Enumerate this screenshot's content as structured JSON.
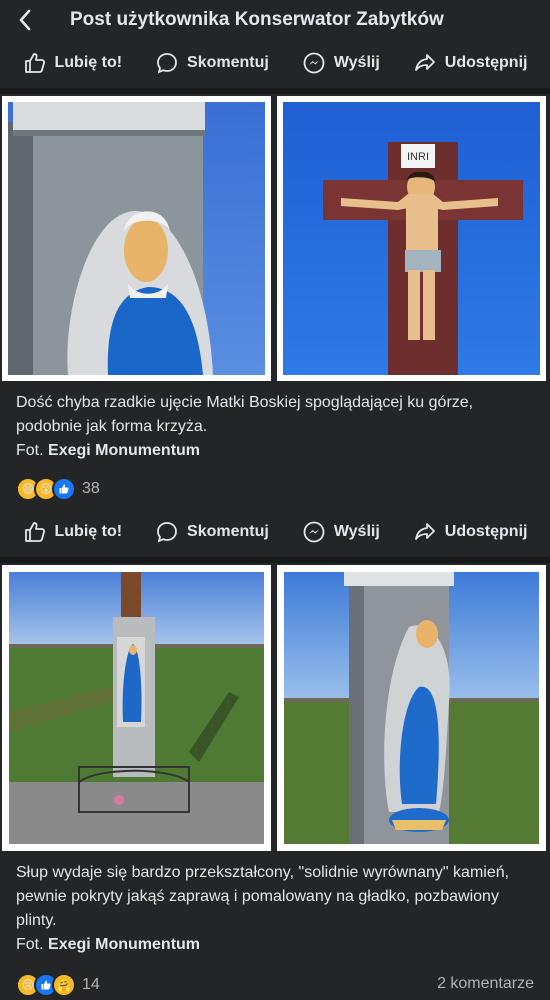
{
  "header": {
    "title": "Post użytkownika Konserwator Zabytków"
  },
  "actions": {
    "like": "Lubię to!",
    "comment": "Skomentuj",
    "send": "Wyślij",
    "share": "Udostępnij"
  },
  "post1": {
    "caption": "Dość chyba rzadkie ujęcie Matki Boskiej spoglądającej ku górze, podobnie jak forma krzyża.",
    "credit_prefix": "Fot.",
    "credit_name": "Exegi Monumentum",
    "reaction_count": "38",
    "inri": "INRI"
  },
  "post2": {
    "caption": "Słup wydaje się bardzo przekształcony, \"solidnie wyrównany\" kamień, pewnie pokryty jakąś zaprawą i pomalowany na gładko, pozbawiony plinty.",
    "credit_prefix": "Fot.",
    "credit_name": "Exegi Monumentum",
    "reaction_count": "14",
    "comments": "2 komentarze"
  },
  "colors": {
    "background": "#242526",
    "like_blue": "#1877f2",
    "sky": "#2f6fe0",
    "field": "#5a7a3a"
  },
  "icons": [
    "chevron-left-icon",
    "thumbs-up-icon",
    "comment-bubble-icon",
    "messenger-icon",
    "share-arrow-icon"
  ]
}
